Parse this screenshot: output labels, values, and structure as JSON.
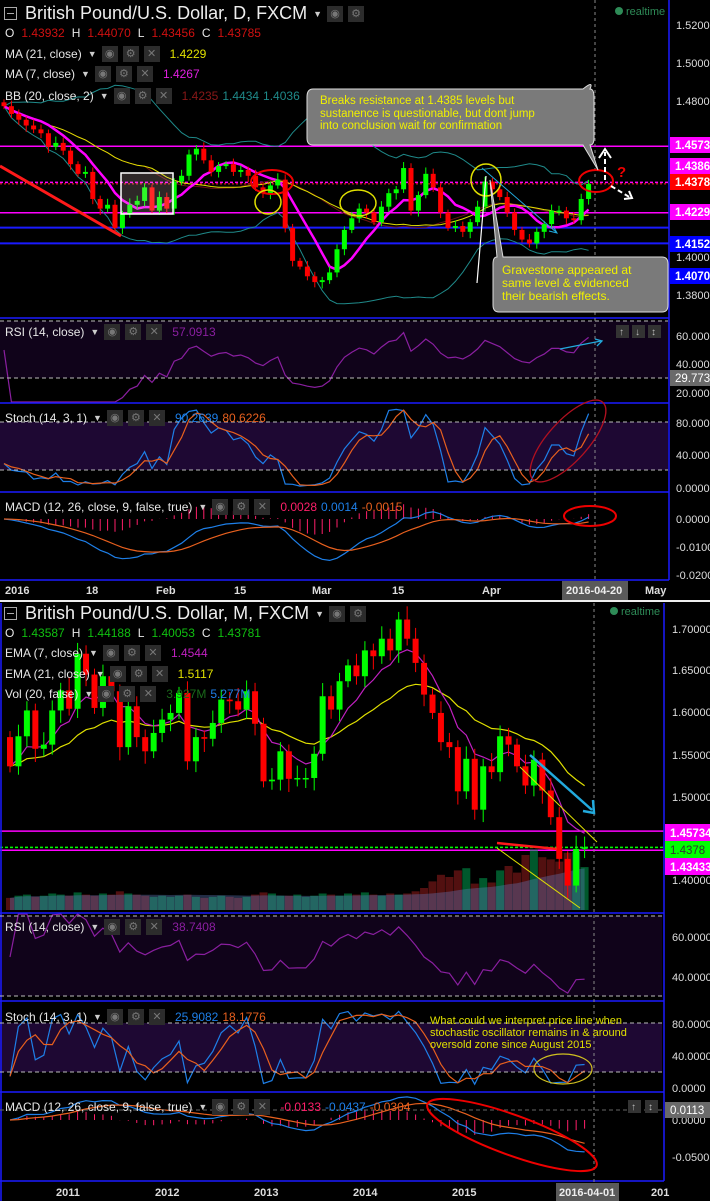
{
  "top": {
    "title": "British Pound/U.S. Dollar, D, FXCM",
    "realtime": "realtime",
    "ohlc": {
      "o_label": "O",
      "o": "1.43932",
      "h_label": "H",
      "h": "1.44070",
      "l_label": "L",
      "l": "1.43456",
      "c_label": "C",
      "c": "1.43785"
    },
    "indicators": [
      {
        "label": "MA (21, close)",
        "values": [
          "1.4229"
        ]
      },
      {
        "label": "MA (7, close)",
        "values": [
          "1.4267"
        ]
      },
      {
        "label": "BB (20, close, 2)",
        "values": [
          "1.4235",
          "1.4434",
          "1.4036"
        ]
      }
    ],
    "rsi": {
      "label": "RSI (14, close)",
      "value": "57.0913",
      "marker": "29.773"
    },
    "stoch": {
      "label": "Stoch (14, 3, 1)",
      "k": "90.2639",
      "d": "80.6226"
    },
    "macd": {
      "label": "MACD (12, 26, close, 9, false, true)",
      "hist": "0.0028",
      "macd": "0.0014",
      "signal": "-0.0015"
    },
    "price_labels": [
      "1.4573",
      "1.4386",
      "1.4378",
      "1.4229",
      "1.4152",
      "1.4070"
    ],
    "axis_ticks": [
      "1.5200",
      "1.5000",
      "1.4800",
      "1.4000",
      "1.3800"
    ],
    "rsi_ticks": [
      "60.0000",
      "40.0000",
      "20.0000"
    ],
    "stoch_ticks": [
      "80.0000",
      "40.0000",
      "0.0000"
    ],
    "macd_ticks": [
      "0.0000",
      "-0.0100",
      "-0.0200"
    ],
    "time_ticks": [
      "2016",
      "18",
      "Feb",
      "15",
      "Mar",
      "15",
      "Apr",
      "May"
    ],
    "cursor_date": "2016-04-20",
    "annotations": {
      "resistance": [
        "Breaks resistance at 1.4385 levels but",
        "sustanence is questionable, but dont jump",
        "into conclusion wait for confirmation"
      ],
      "gravestone": [
        "Gravestone appeared at",
        "same level & evidenced",
        "their bearish effects."
      ],
      "question": "?"
    }
  },
  "bottom": {
    "title": "British Pound/U.S. Dollar, M, FXCM",
    "realtime": "realtime",
    "ohlc": {
      "o_label": "O",
      "o": "1.43587",
      "h_label": "H",
      "h": "1.44188",
      "l_label": "L",
      "l": "1.40053",
      "c_label": "C",
      "c": "1.43781"
    },
    "indicators": [
      {
        "label": "EMA (7, close)",
        "values": [
          "1.4544"
        ]
      },
      {
        "label": "EMA (21, close)",
        "values": [
          "1.5117"
        ]
      },
      {
        "label": "Vol (20, false)",
        "values": [
          "3.927M",
          "5.277M"
        ]
      }
    ],
    "rsi": {
      "label": "RSI (14, close)",
      "value": "38.7408"
    },
    "stoch": {
      "label": "Stoch (14, 3, 1)",
      "k": "25.9082",
      "d": "18.1776"
    },
    "macd": {
      "label": "MACD (12, 26, close, 9, false, true)",
      "hist": "-0.0133",
      "macd": "-0.0437",
      "signal": "-0.0304",
      "marker": "0.0113"
    },
    "price_labels": [
      "1.45734",
      "1.4378",
      "1.43433"
    ],
    "axis_ticks": [
      "1.70000",
      "1.65000",
      "1.60000",
      "1.55000",
      "1.50000",
      "1.40000"
    ],
    "rsi_ticks": [
      "60.0000",
      "40.0000"
    ],
    "stoch_ticks": [
      "80.0000",
      "40.0000",
      "0.0000"
    ],
    "macd_ticks": [
      "0.0000",
      "-0.0500"
    ],
    "time_ticks": [
      "2011",
      "2012",
      "2013",
      "2014",
      "2015",
      "201"
    ],
    "cursor_date": "2016-04-01",
    "annotations": {
      "stoch_note": [
        "What could we interpret price line when",
        "stochastic oscillator remains in & around",
        "oversold zone since August 2015"
      ]
    }
  },
  "colors": {
    "up": "#00ff00",
    "down": "#ff0000",
    "ma21": "#e0e000",
    "ma7": "#ff00ff",
    "bb": "#1f8a8a",
    "rsi": "#8a1fa0",
    "stoch_k": "#1e7fe8",
    "stoch_d": "#e8601e",
    "macd_hist": "#ff1f6a",
    "axis": "#1a1aff"
  },
  "chart_data": [
    {
      "type": "candlestick",
      "title": "British Pound/U.S. Dollar, D, FXCM",
      "x_range": [
        "2015-12-29",
        "2016-04-20"
      ],
      "ylim": [
        1.37,
        1.525
      ],
      "open_first": 1.48,
      "close": [
        1.478,
        1.474,
        1.471,
        1.468,
        1.466,
        1.464,
        1.457,
        1.459,
        1.455,
        1.448,
        1.443,
        1.444,
        1.43,
        1.425,
        1.427,
        1.415,
        1.422,
        1.427,
        1.429,
        1.436,
        1.424,
        1.431,
        1.425,
        1.439,
        1.442,
        1.453,
        1.456,
        1.45,
        1.444,
        1.447,
        1.448,
        1.444,
        1.445,
        1.442,
        1.436,
        1.433,
        1.437,
        1.44,
        1.415,
        1.398,
        1.395,
        1.39,
        1.387,
        1.388,
        1.392,
        1.404,
        1.414,
        1.42,
        1.425,
        1.423,
        1.418,
        1.426,
        1.433,
        1.435,
        1.446,
        1.424,
        1.432,
        1.443,
        1.436,
        1.423,
        1.415,
        1.416,
        1.413,
        1.418,
        1.426,
        1.439,
        1.435,
        1.431,
        1.423,
        1.414,
        1.409,
        1.407,
        1.413,
        1.417,
        1.424,
        1.424,
        1.42,
        1.419,
        1.43,
        1.4378
      ],
      "levels": [
        1.4573,
        1.4386,
        1.4378,
        1.4229,
        1.4152,
        1.407
      ]
    },
    {
      "type": "candlestick",
      "title": "British Pound/U.S. Dollar, M, FXCM",
      "x_range": [
        "2010-08",
        "2016-04"
      ],
      "ylim": [
        1.36,
        1.72
      ],
      "open_first": 1.57,
      "close": [
        1.535,
        1.571,
        1.602,
        1.556,
        1.561,
        1.602,
        1.626,
        1.604,
        1.67,
        1.645,
        1.605,
        1.643,
        1.625,
        1.558,
        1.607,
        1.57,
        1.553,
        1.575,
        1.591,
        1.599,
        1.623,
        1.541,
        1.57,
        1.568,
        1.587,
        1.615,
        1.613,
        1.603,
        1.625,
        1.586,
        1.517,
        1.519,
        1.553,
        1.52,
        1.521,
        1.521,
        1.55,
        1.619,
        1.603,
        1.637,
        1.656,
        1.643,
        1.674,
        1.667,
        1.688,
        1.674,
        1.711,
        1.688,
        1.659,
        1.621,
        1.599,
        1.564,
        1.558,
        1.505,
        1.544,
        1.483,
        1.535,
        1.528,
        1.571,
        1.561,
        1.535,
        1.512,
        1.543,
        1.506,
        1.474,
        1.424,
        1.392,
        1.436,
        1.4378
      ],
      "volume_millions": [
        1.1,
        1.3,
        1.4,
        1.2,
        1.3,
        1.5,
        1.4,
        1.3,
        1.6,
        1.4,
        1.3,
        1.5,
        1.4,
        1.7,
        1.5,
        1.4,
        1.3,
        1.2,
        1.3,
        1.2,
        1.3,
        1.4,
        1.2,
        1.1,
        1.2,
        1.3,
        1.2,
        1.1,
        1.2,
        1.4,
        1.6,
        1.5,
        1.3,
        1.3,
        1.4,
        1.2,
        1.3,
        1.5,
        1.4,
        1.3,
        1.5,
        1.4,
        1.6,
        1.4,
        1.3,
        1.5,
        1.4,
        1.5,
        1.7,
        2.0,
        2.6,
        3.2,
        3.0,
        3.6,
        3.8,
        2.4,
        2.9,
        2.5,
        3.6,
        4.0,
        3.4,
        5.0,
        5.5,
        4.8,
        4.6,
        4.4,
        5.2,
        5.3,
        3.9
      ],
      "levels": [
        1.45734,
        1.4378,
        1.43433
      ]
    }
  ]
}
